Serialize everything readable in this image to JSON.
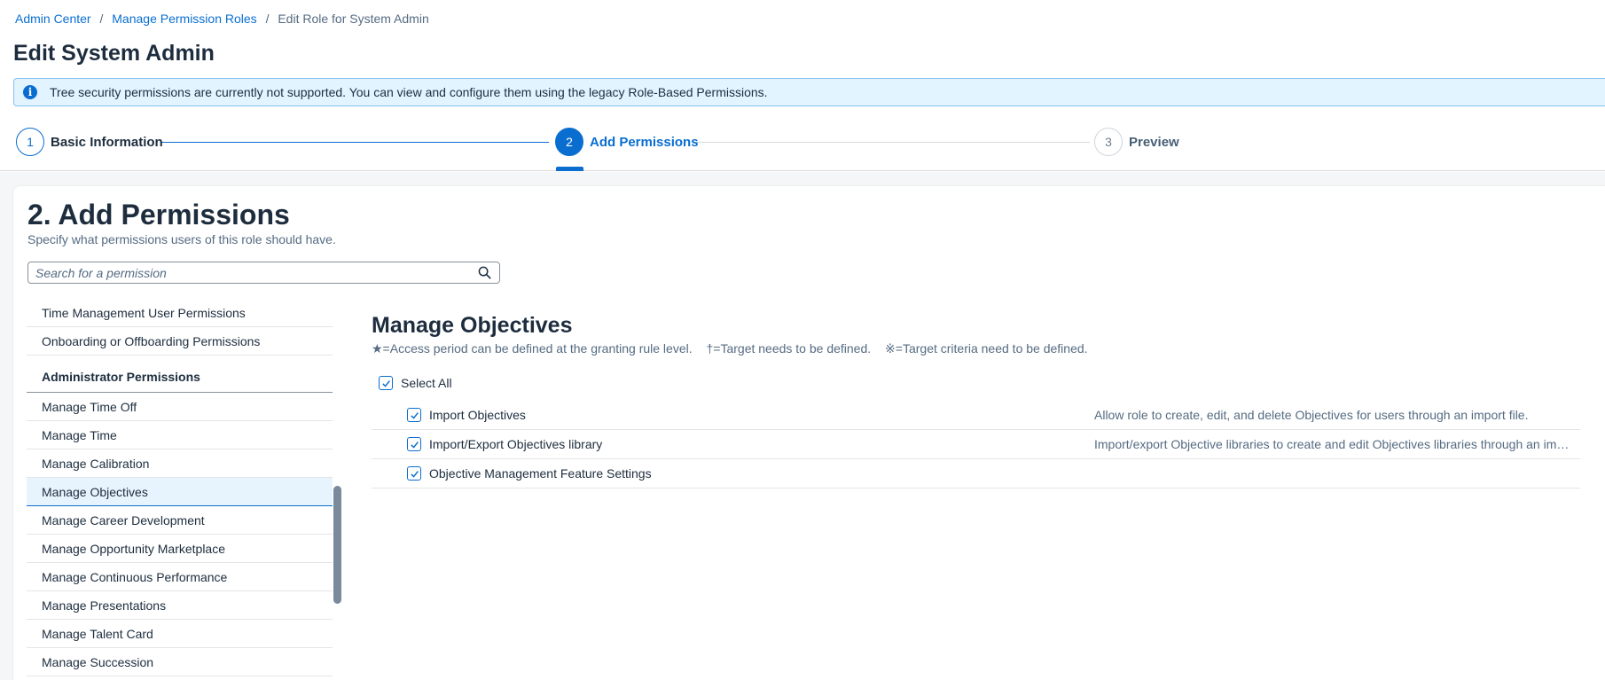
{
  "breadcrumb": {
    "items": [
      "Admin Center",
      "Manage Permission Roles"
    ],
    "separator": "/",
    "current": "Edit Role for System Admin"
  },
  "page": {
    "title": "Edit System Admin"
  },
  "info_banner": {
    "icon": "info-icon",
    "text": "Tree security permissions are currently not supported. You can view and configure them using the legacy Role-Based Permissions."
  },
  "wizard": {
    "steps": [
      {
        "number": "1",
        "label": "Basic Information",
        "state": "done"
      },
      {
        "number": "2",
        "label": "Add Permissions",
        "state": "active"
      },
      {
        "number": "3",
        "label": "Preview",
        "state": "todo"
      }
    ]
  },
  "section": {
    "title": "2. Add Permissions",
    "subtitle": "Specify what permissions users of this role should have."
  },
  "search": {
    "placeholder": "Search for a permission",
    "value": ""
  },
  "left_list": {
    "items_top": [
      "Time Management User Permissions",
      "Onboarding or Offboarding Permissions"
    ],
    "group_header": "Administrator Permissions",
    "items": [
      "Manage Time Off",
      "Manage Time",
      "Manage Calibration",
      "Manage Objectives",
      "Manage Career Development",
      "Manage Opportunity Marketplace",
      "Manage Continuous Performance",
      "Manage Presentations",
      "Manage Talent Card",
      "Manage Succession"
    ],
    "selected": "Manage Objectives"
  },
  "detail": {
    "title": "Manage Objectives",
    "legend": [
      "★=Access period can be defined at the granting rule level.",
      "†=Target needs to be defined.",
      "※=Target criteria need to be defined."
    ],
    "select_all_label": "Select All",
    "select_all_checked": true,
    "permissions": [
      {
        "name": "Import Objectives",
        "description": "Allow role to create, edit, and delete Objectives for users through an import file.",
        "checked": true
      },
      {
        "name": "Import/Export Objectives library",
        "description": "Import/export Objective libraries to create and edit Objectives libraries through an import file.",
        "checked": true
      },
      {
        "name": "Objective Management Feature Settings",
        "description": "",
        "checked": true
      }
    ]
  },
  "colors": {
    "accent": "#0a6ed1",
    "info_bg": "#e1f4ff",
    "text": "#1d2d3e",
    "muted": "#556b82"
  }
}
